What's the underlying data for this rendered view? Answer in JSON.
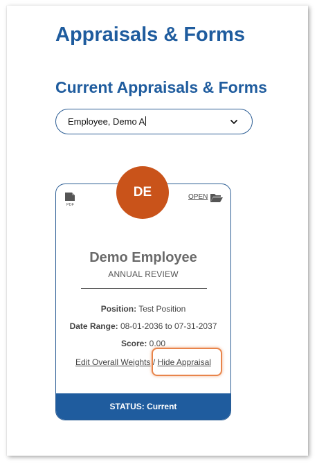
{
  "page": {
    "title": "Appraisals & Forms",
    "section_title": "Current Appraisals & Forms"
  },
  "employee_select": {
    "value": "Employee, Demo A"
  },
  "card": {
    "avatar_initials": "DE",
    "pdf_icon_label": "PDF",
    "open_label": "OPEN",
    "employee_name": "Demo Employee",
    "review_type": "ANNUAL REVIEW",
    "position_label": "Position:",
    "position_value": "Test Position",
    "date_range_label": "Date Range:",
    "date_range_value": "08-01-2036 to 07-31-2037",
    "score_label": "Score:",
    "score_value": "0.00",
    "edit_weights_label": "Edit Overall Weights",
    "separator": "/",
    "hide_appraisal_label": "Hide Appraisal",
    "status_text": "STATUS: Current"
  },
  "colors": {
    "brand_blue": "#1f5c9e",
    "avatar_orange": "#c9531a",
    "highlight_orange": "#e8844a"
  },
  "icons": {
    "pdf": "pdf-file-icon",
    "open": "folder-open-icon",
    "dropdown": "chevron-down-icon"
  }
}
